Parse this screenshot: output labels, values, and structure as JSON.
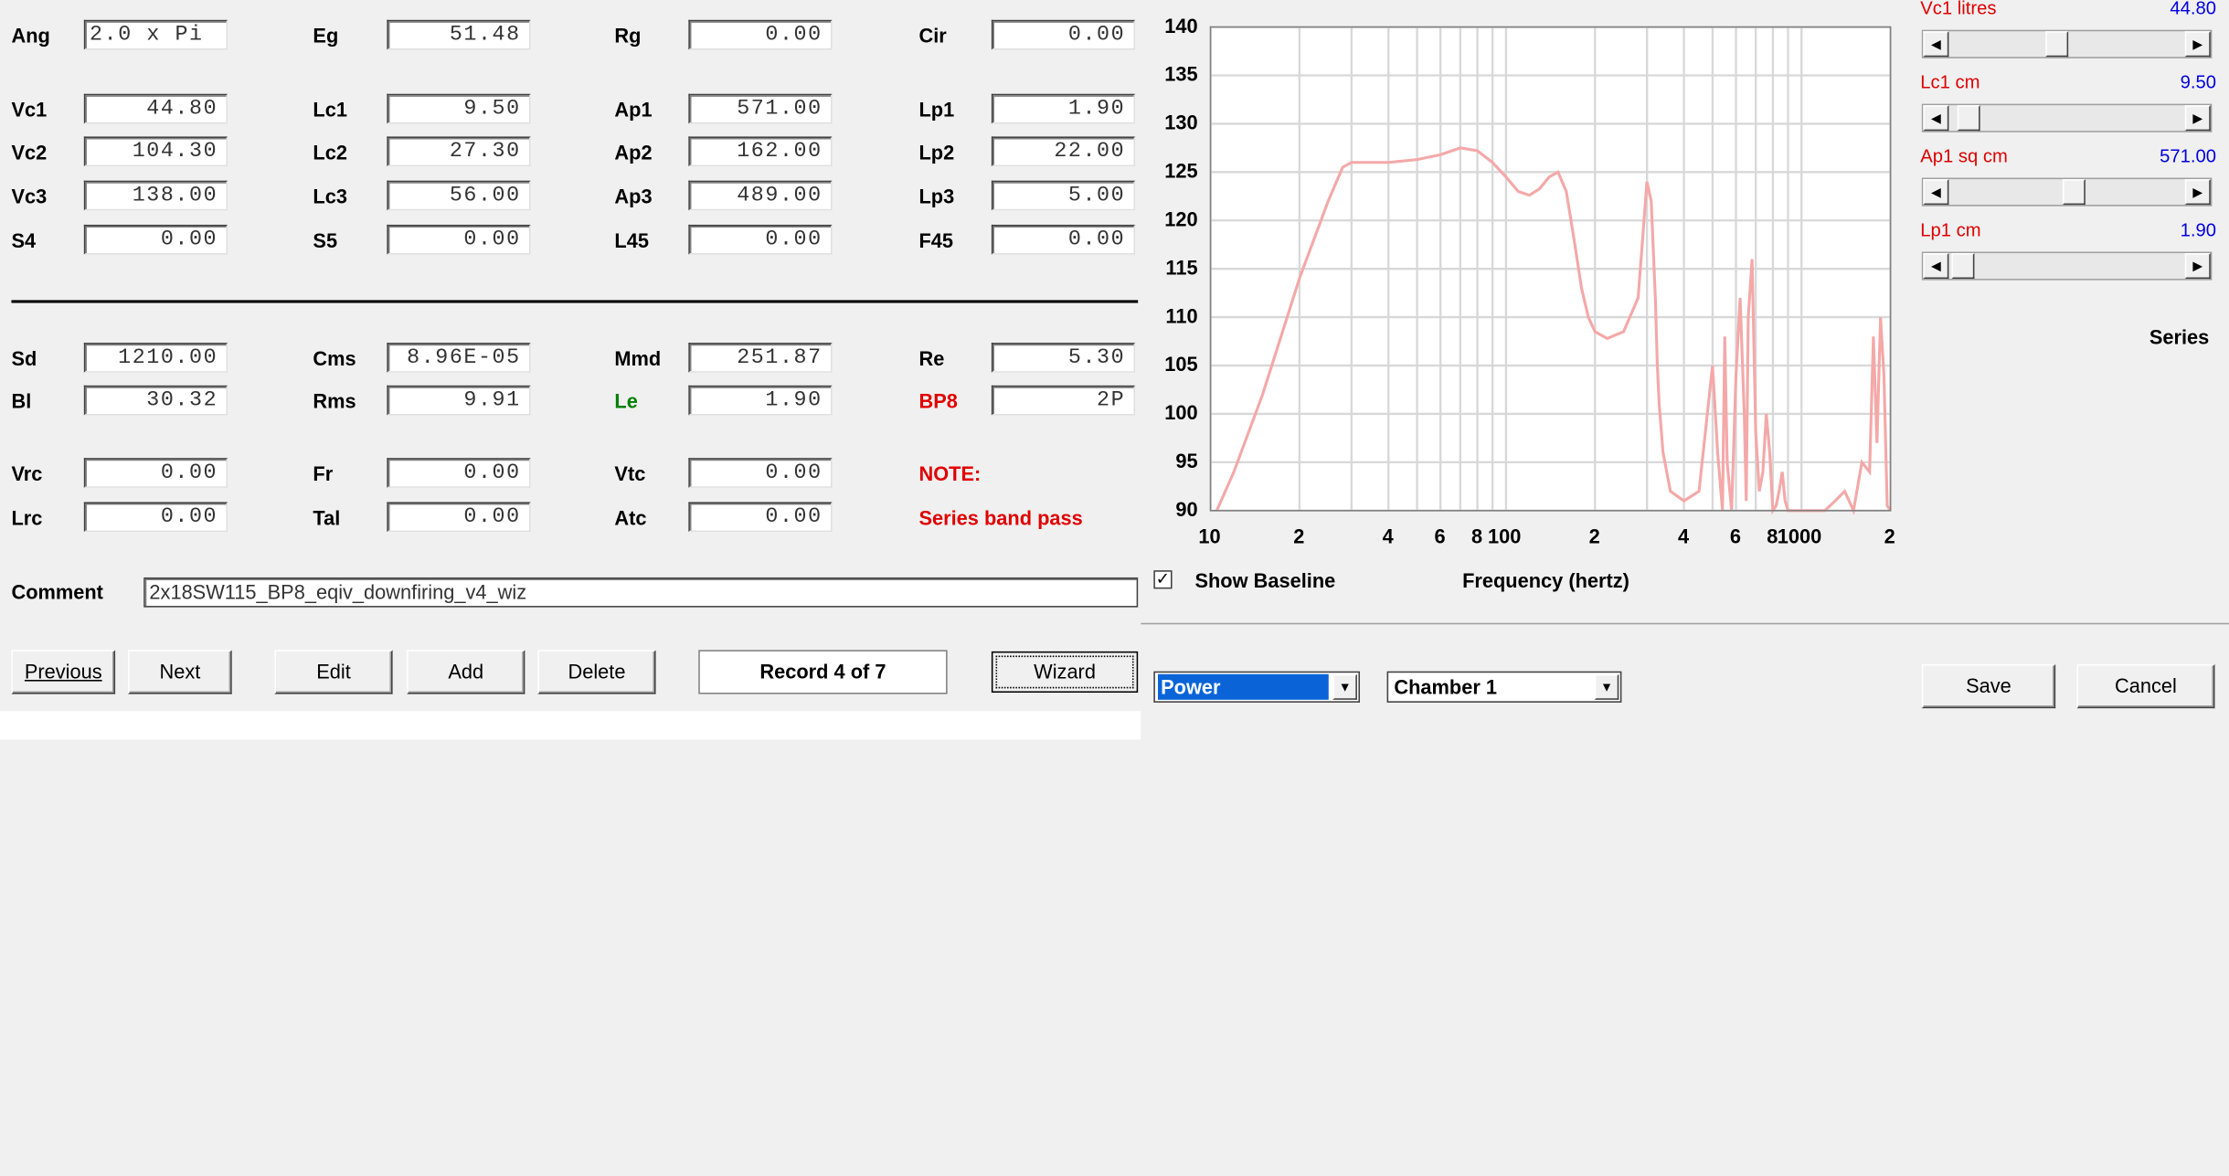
{
  "params": {
    "ang": {
      "label": "Ang",
      "value": "2.0 x Pi"
    },
    "eg": {
      "label": "Eg",
      "value": "51.48"
    },
    "rg": {
      "label": "Rg",
      "value": "0.00"
    },
    "cir": {
      "label": "Cir",
      "value": "0.00"
    },
    "vc1": {
      "label": "Vc1",
      "value": "44.80"
    },
    "lc1": {
      "label": "Lc1",
      "value": "9.50"
    },
    "ap1": {
      "label": "Ap1",
      "value": "571.00"
    },
    "lp1": {
      "label": "Lp1",
      "value": "1.90"
    },
    "vc2": {
      "label": "Vc2",
      "value": "104.30"
    },
    "lc2": {
      "label": "Lc2",
      "value": "27.30"
    },
    "ap2": {
      "label": "Ap2",
      "value": "162.00"
    },
    "lp2": {
      "label": "Lp2",
      "value": "22.00"
    },
    "vc3": {
      "label": "Vc3",
      "value": "138.00"
    },
    "lc3": {
      "label": "Lc3",
      "value": "56.00"
    },
    "ap3": {
      "label": "Ap3",
      "value": "489.00"
    },
    "lp3": {
      "label": "Lp3",
      "value": "5.00"
    },
    "s4": {
      "label": "S4",
      "value": "0.00"
    },
    "s5": {
      "label": "S5",
      "value": "0.00"
    },
    "l45": {
      "label": "L45",
      "value": "0.00"
    },
    "f45": {
      "label": "F45",
      "value": "0.00"
    },
    "sd": {
      "label": "Sd",
      "value": "1210.00"
    },
    "cms": {
      "label": "Cms",
      "value": "8.96E-05"
    },
    "mmd": {
      "label": "Mmd",
      "value": "251.87"
    },
    "re": {
      "label": "Re",
      "value": "5.30"
    },
    "bl": {
      "label": "Bl",
      "value": "30.32"
    },
    "rms": {
      "label": "Rms",
      "value": "9.91"
    },
    "le": {
      "label": "Le",
      "value": "1.90"
    },
    "bp8": {
      "label": "BP8",
      "value": "2P"
    },
    "vrc": {
      "label": "Vrc",
      "value": "0.00"
    },
    "fr": {
      "label": "Fr",
      "value": "0.00"
    },
    "vtc": {
      "label": "Vtc",
      "value": "0.00"
    },
    "lrc": {
      "label": "Lrc",
      "value": "0.00"
    },
    "tal": {
      "label": "Tal",
      "value": "0.00"
    },
    "atc": {
      "label": "Atc",
      "value": "0.00"
    }
  },
  "note": {
    "title": "NOTE:",
    "text": "Series band pass"
  },
  "comment": {
    "label": "Comment",
    "value": "2x18SW115_BP8_eqiv_downfiring_v4_wiz"
  },
  "buttons": {
    "previous": "Previous",
    "next": "Next",
    "edit": "Edit",
    "add": "Add",
    "delete": "Delete",
    "wizard": "Wizard",
    "save": "Save",
    "cancel": "Cancel"
  },
  "record": "Record 4 of 7",
  "chart": {
    "show_baseline_label": "Show Baseline",
    "show_baseline_checked": true,
    "xlabel": "Frequency (hertz)",
    "y_ticks": [
      "140",
      "135",
      "130",
      "125",
      "120",
      "115",
      "110",
      "105",
      "100",
      "95",
      "90"
    ],
    "x_ticks": [
      "10",
      "2",
      "4",
      "6",
      "8",
      "100",
      "2",
      "4",
      "6",
      "8",
      "1000",
      "2"
    ],
    "curve_color": "#f4a8a8"
  },
  "chart_data": {
    "type": "line",
    "title": "",
    "xlabel": "Frequency (hertz)",
    "ylabel": "",
    "x_scale": "log",
    "xlim": [
      10,
      2000
    ],
    "ylim": [
      90,
      140
    ],
    "grid": true,
    "series": [
      {
        "x": [
          10.5,
          12,
          15,
          20,
          25,
          28,
          30,
          32,
          35,
          40,
          50,
          60,
          70,
          80,
          90,
          100,
          110,
          120,
          130,
          140,
          150,
          160,
          170,
          180,
          190,
          200,
          220,
          250,
          280,
          300,
          310,
          320,
          325,
          330,
          340,
          360,
          400,
          450,
          500,
          520,
          540,
          550,
          560,
          580,
          600,
          620,
          640,
          650,
          660,
          680,
          700,
          720,
          740,
          760,
          780,
          800,
          820,
          840,
          860,
          880,
          900,
          950,
          1000,
          1100,
          1200,
          1300,
          1400,
          1500,
          1600,
          1700,
          1750,
          1800,
          1850,
          1900,
          1950,
          2000
        ],
        "y": [
          90,
          94,
          102,
          114,
          122,
          125.5,
          126,
          126,
          126,
          126,
          126.3,
          126.8,
          127.5,
          127.2,
          126,
          124.5,
          123,
          122.6,
          123.3,
          124.5,
          125,
          123,
          118,
          113,
          110,
          108.5,
          107.8,
          108.5,
          112,
          124,
          122,
          112,
          105,
          101,
          96,
          92,
          91,
          92,
          105,
          96,
          90,
          108,
          95,
          90,
          104,
          112,
          100,
          91,
          110,
          116,
          98,
          92,
          94,
          100,
          96,
          90,
          90.5,
          92,
          94,
          91,
          90,
          90,
          90,
          90,
          90,
          91,
          92,
          90,
          95,
          94,
          108,
          97,
          110,
          104,
          90.5,
          90
        ]
      }
    ]
  },
  "combos": {
    "mode": "Power",
    "chamber": "Chamber 1"
  },
  "sliders": [
    {
      "label": "Vc1  litres",
      "value": "44.80",
      "position": 0.45
    },
    {
      "label": "Lc1  cm",
      "value": "9.50",
      "position": 0.04
    },
    {
      "label": "Ap1  sq cm",
      "value": "571.00",
      "position": 0.53
    },
    {
      "label": "Lp1  cm",
      "value": "1.90",
      "position": 0.01
    }
  ],
  "series_label": "Series"
}
